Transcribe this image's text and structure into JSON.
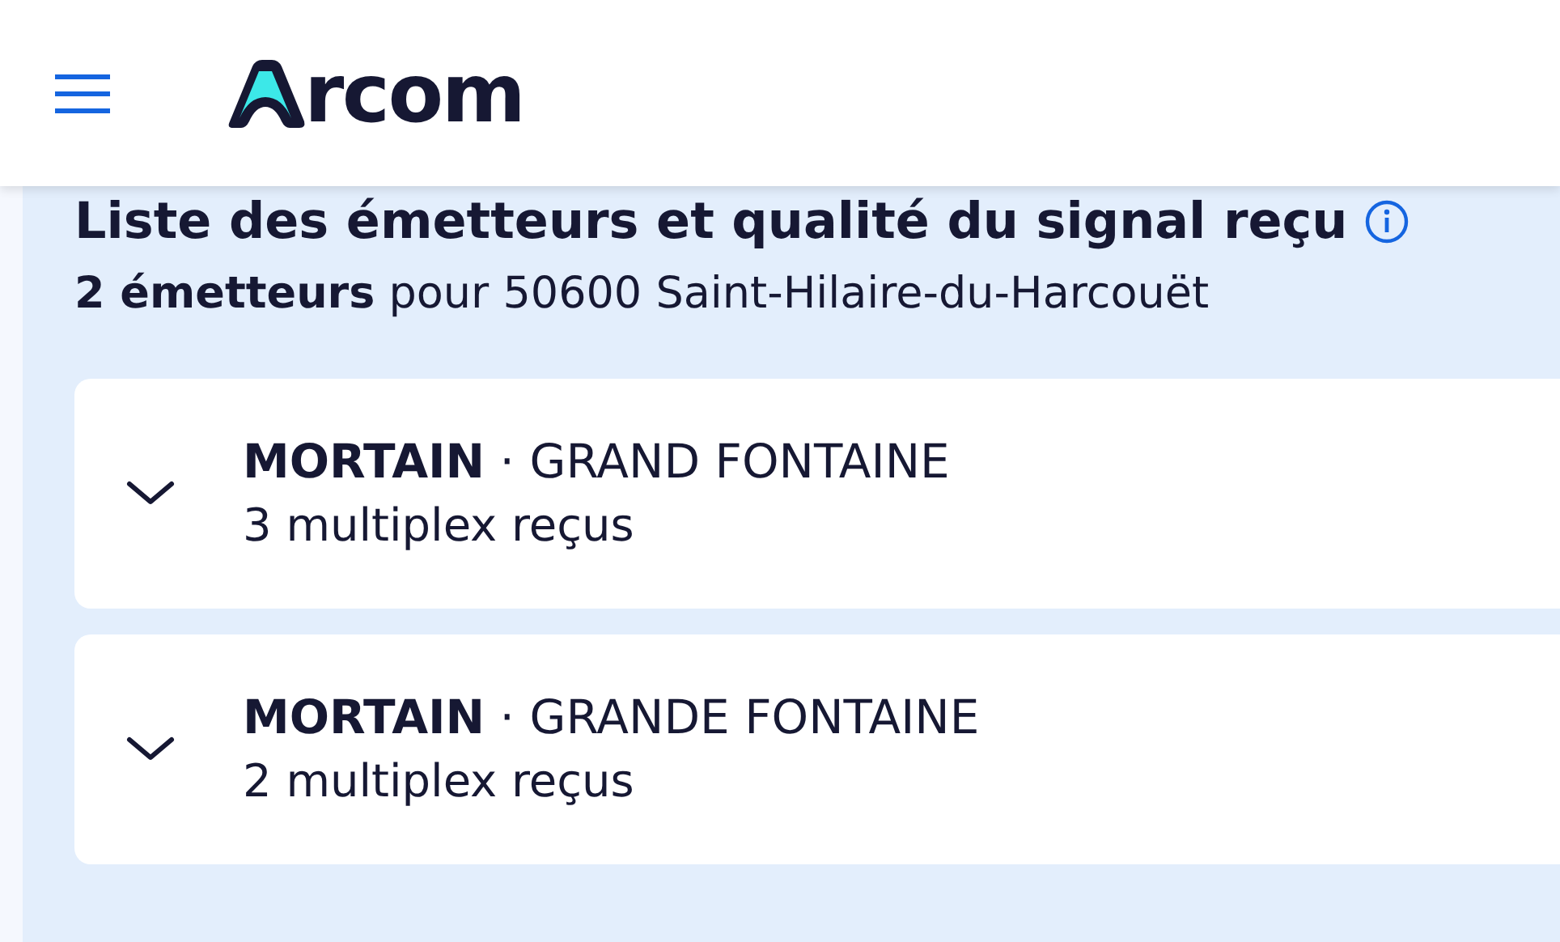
{
  "header": {
    "logo_text": "rcom"
  },
  "section": {
    "title": "Liste des émetteurs et qualité du signal reçu",
    "summary": "**2 émetteurs** pour 50600 Saint-Hilaire-du-Harcouët"
  },
  "transmitters": [
    {
      "name": "**MORTAIN** · GRAND FONTAINE",
      "detail": "3 multiplex reçus",
      "expanded": false
    },
    {
      "name": "**MORTAIN** · GRANDE FONTAINE",
      "detail": "2 multiplex reçus",
      "expanded": false
    }
  ]
}
